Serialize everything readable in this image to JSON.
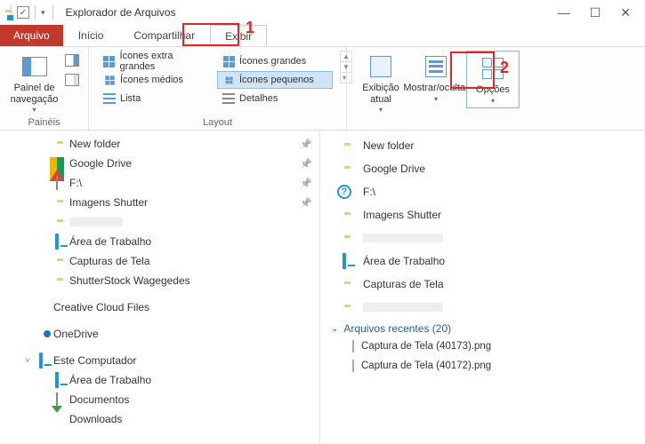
{
  "titlebar": {
    "title": "Explorador de Arquivos"
  },
  "tabs": {
    "file": "Arquivo",
    "home": "Início",
    "share": "Compartilhar",
    "view": "Exibir"
  },
  "ribbon": {
    "panes_group": "Painéis",
    "nav_panel": "Painel de navegação",
    "layout_group": "Layout",
    "layout": {
      "extra_large": "Ícones extra grandes",
      "large": "Ícones grandes",
      "medium": "Ícones médios",
      "small": "Ícones pequenos",
      "list": "Lista",
      "details": "Detalhes"
    },
    "current_view": "Exibição atual",
    "show_hide": "Mostrar/ocultar",
    "options": "Opções"
  },
  "annotations": {
    "one": "1",
    "two": "2"
  },
  "nav_tree": [
    {
      "indent": 2,
      "icon": "folder",
      "label": "New folder",
      "pin": true,
      "blurred": false
    },
    {
      "indent": 2,
      "icon": "gdrive",
      "label": "Google Drive",
      "pin": true
    },
    {
      "indent": 2,
      "icon": "drive",
      "label": "F:\\",
      "pin": true
    },
    {
      "indent": 2,
      "icon": "folder",
      "label": "Imagens Shutter",
      "pin": true
    },
    {
      "indent": 2,
      "icon": "folder",
      "label": "",
      "pin": false,
      "blurred": true
    },
    {
      "indent": 2,
      "icon": "monitor",
      "label": "Área de Trabalho",
      "pin": false
    },
    {
      "indent": 2,
      "icon": "folder",
      "label": "Capturas de Tela",
      "pin": false
    },
    {
      "indent": 2,
      "icon": "folder",
      "label": "ShutterStock Wagegedes",
      "pin": false
    },
    {
      "indent": 1,
      "icon": "cc",
      "label": "Creative Cloud Files",
      "pin": false,
      "gap": true
    },
    {
      "indent": 1,
      "icon": "cloud",
      "label": "OneDrive",
      "pin": false,
      "gap": true
    },
    {
      "indent": 1,
      "icon": "monitor",
      "label": "Este Computador",
      "pin": false,
      "gap": true,
      "exp": "˅"
    },
    {
      "indent": 2,
      "icon": "monitor",
      "label": "Área de Trabalho",
      "pin": false
    },
    {
      "indent": 2,
      "icon": "doc",
      "label": "Documentos",
      "pin": false
    },
    {
      "indent": 2,
      "icon": "down",
      "label": "Downloads",
      "pin": false
    }
  ],
  "main_list": [
    {
      "icon": "folder",
      "label": "New folder"
    },
    {
      "icon": "folder",
      "label": "Google Drive"
    },
    {
      "icon": "help",
      "label": "F:\\"
    },
    {
      "icon": "folder",
      "label": "Imagens Shutter"
    },
    {
      "icon": "folder",
      "label": "",
      "blurred": true
    },
    {
      "icon": "monitor",
      "label": "Área de Trabalho"
    },
    {
      "icon": "folder",
      "label": "Capturas de Tela"
    },
    {
      "icon": "folder",
      "label": "",
      "blurred": true
    }
  ],
  "recent": {
    "header": "Arquivos recentes (20)",
    "items": [
      {
        "icon": "img",
        "label": "Captura de Tela (40173).png"
      },
      {
        "icon": "img",
        "label": "Captura de Tela (40172).png"
      }
    ]
  }
}
